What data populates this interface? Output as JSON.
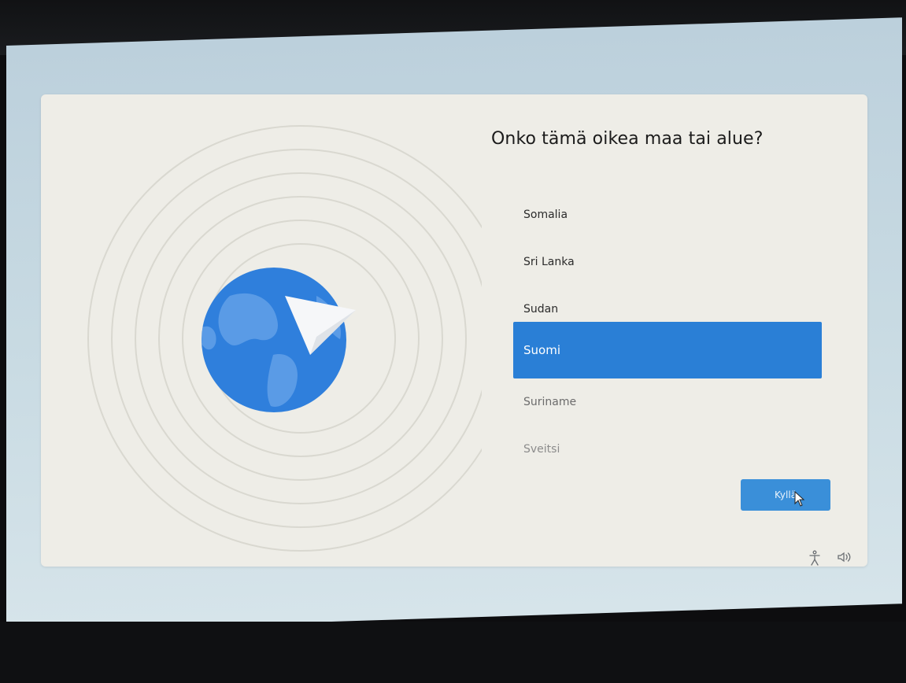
{
  "setup": {
    "question": "Onko tämä oikea maa tai alue?",
    "countries": [
      {
        "label": "Somalia"
      },
      {
        "label": "Sri Lanka"
      },
      {
        "label": "Sudan"
      },
      {
        "label": "Suomi",
        "selected": true
      },
      {
        "label": "Suriname"
      },
      {
        "label": "Sveitsi"
      }
    ],
    "yes_button_label": "Kyllä"
  },
  "footer": {
    "accessibility_icon": "accessibility-icon",
    "volume_icon": "volume-icon"
  },
  "colors": {
    "accent": "#2a7fd6",
    "card_background": "#eeede7",
    "button": "#3a8fd9"
  }
}
